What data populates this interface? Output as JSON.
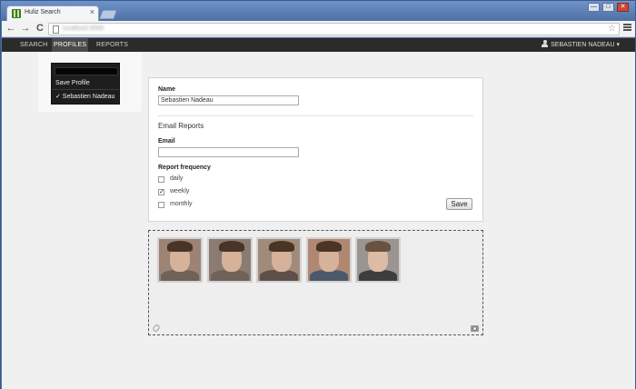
{
  "browser": {
    "tab_title": "Huliz Search",
    "tab_close": "×",
    "url": "localhost:3000",
    "back": "←",
    "forward": "→",
    "reload": "C",
    "star": "☆",
    "win_minimize": "—",
    "win_maximize": "□",
    "win_close": "✕"
  },
  "nav": {
    "items": [
      "SEARCH",
      "PROFILES",
      "REPORTS"
    ],
    "active_index": 1,
    "user": "SEBASTIEN NADEAU",
    "user_caret": "▾"
  },
  "dropdown": {
    "input_value": "",
    "items": [
      "Save Profile",
      "✓ Sebastien Nadeau"
    ]
  },
  "form": {
    "name_label": "Name",
    "name_value": "Sebastien Nadeau",
    "section_title": "Email Reports",
    "email_label": "Email",
    "email_value": "",
    "frequency_label": "Report frequency",
    "options": [
      {
        "label": "daily",
        "checked": false
      },
      {
        "label": "weekly",
        "checked": true
      },
      {
        "label": "monthly",
        "checked": false
      }
    ],
    "save_label": "Save",
    "check_mark": "✓"
  },
  "photos": {
    "count": 5
  },
  "colors": {
    "nav_bg": "#2b2b2b",
    "page_bg": "#f0f0f0",
    "window_frame": "#4f72a8"
  }
}
